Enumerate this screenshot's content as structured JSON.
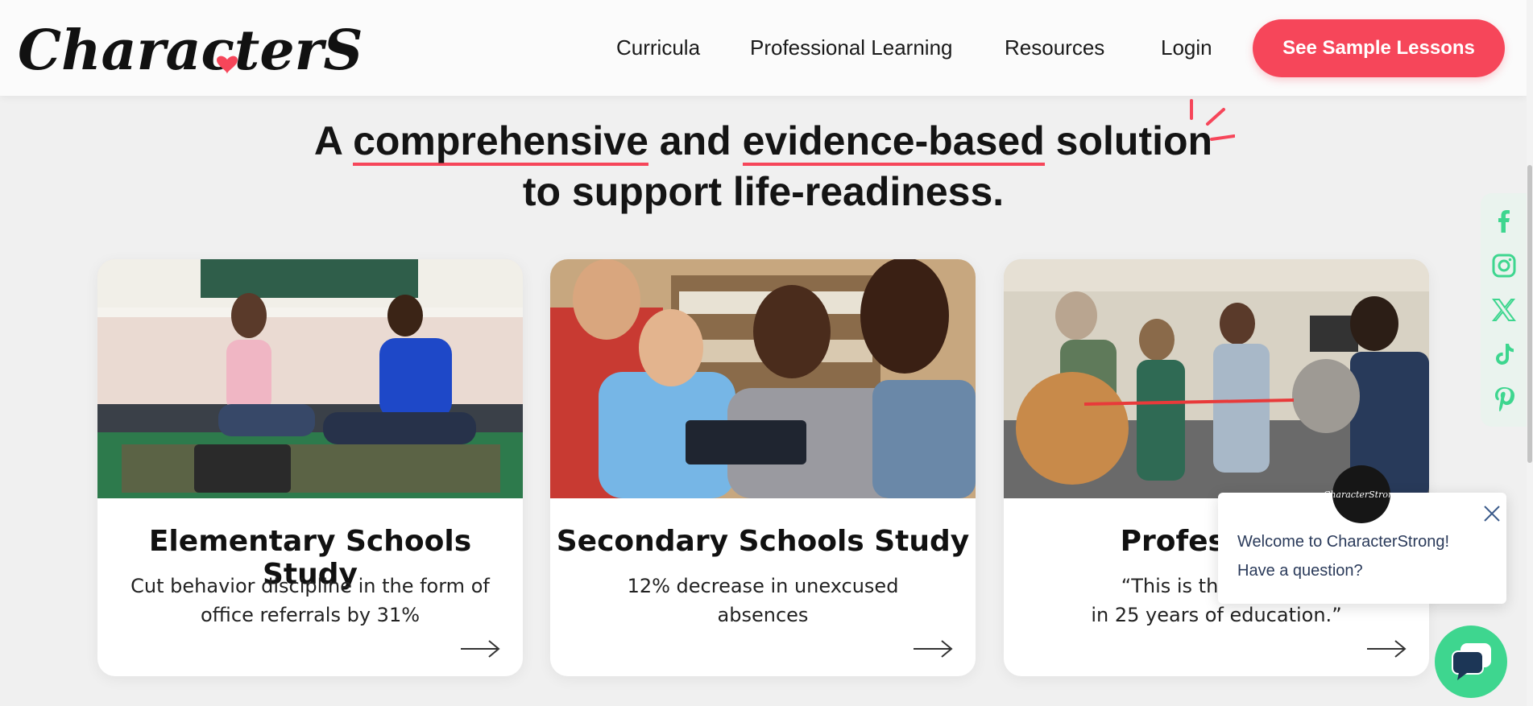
{
  "header": {
    "logo_text": "CharacterStrong",
    "nav": [
      "Curricula",
      "Professional Learning",
      "Resources",
      "Login"
    ],
    "cta_label": "See Sample Lessons"
  },
  "hero": {
    "line1_prefix": "A ",
    "line1_emph1": "comprehensive",
    "line1_mid": " and ",
    "line1_emph2": "evidence-based",
    "line1_suffix": " solution",
    "line2": "to support life-readiness."
  },
  "cards": [
    {
      "title": "Elementary Schools Study",
      "desc": "Cut behavior discipline in the form of office referrals by 31%"
    },
    {
      "title": "Secondary Schools Study",
      "desc": "12% decrease in unexcused absences"
    },
    {
      "title": "Professiona",
      "desc": "“This is the best tra                                      in 25 years of education.”"
    }
  ],
  "social": [
    "facebook-icon",
    "instagram-icon",
    "x-icon",
    "tiktok-icon",
    "pinterest-icon"
  ],
  "chat": {
    "avatar_text": "CharacterStrong",
    "line1": "Welcome to CharacterStrong!",
    "line2": "Have a question?"
  },
  "colors": {
    "accent": "#f6465a",
    "social": "#3ed68f"
  }
}
